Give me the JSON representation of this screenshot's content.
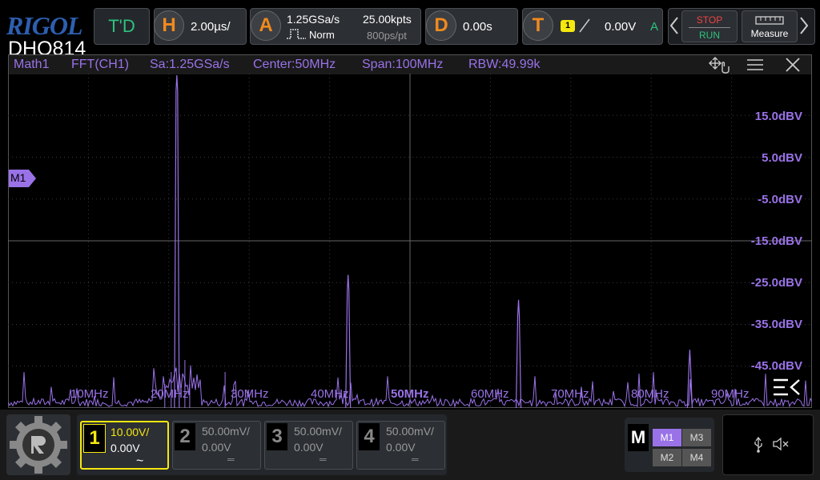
{
  "brand": {
    "logo": "RIGOL",
    "model": "DHO814"
  },
  "topbar": {
    "trigger_status": "T'D",
    "horizontal": {
      "badge": "H",
      "timebase": "2.00µs/"
    },
    "acquire": {
      "badge": "A",
      "sample_rate": "1.25GSa/s",
      "mode": "Norm",
      "memory_depth": "25.00kpts",
      "resolution": "800ps/pt"
    },
    "delay": {
      "badge": "D",
      "value": "0.00s"
    },
    "trigger": {
      "badge": "T",
      "source": "1",
      "level": "0.00V",
      "mode": "A"
    },
    "run_stop": {
      "stop": "STOP",
      "run": "RUN"
    },
    "measure_label": "Measure"
  },
  "math": {
    "title": "Math1",
    "source": "FFT(CH1)",
    "sample_rate": "Sa:1.25GSa/s",
    "center": "Center:50MHz",
    "span": "Span:100MHz",
    "rbw": "RBW:49.99k",
    "marker": "M1"
  },
  "yaxis_labels": [
    "15.0dBV",
    "5.0dBV",
    "-5.0dBV",
    "-15.0dBV",
    "-25.0dBV",
    "-35.0dBV",
    "-45.0dBV"
  ],
  "xaxis_labels": [
    "10MHz",
    "20MHz",
    "30MHz",
    "40MHz",
    "50MHz",
    "60MHz",
    "70MHz",
    "80MHz",
    "90MHz"
  ],
  "spectrum_peaks_mhz_dbv": [
    {
      "f": 21.0,
      "db": 25.0
    },
    {
      "f": 42.3,
      "db": -23.0
    },
    {
      "f": 63.5,
      "db": -29.0
    },
    {
      "f": 84.8,
      "db": -41.0
    }
  ],
  "channels": [
    {
      "num": "1",
      "scale": "10.00V/",
      "offset": "0.00V",
      "coupling": "~",
      "active": true,
      "color": "#f5e80f"
    },
    {
      "num": "2",
      "scale": "50.00mV/",
      "offset": "0.00V",
      "coupling": "═",
      "active": false,
      "color": "#888888"
    },
    {
      "num": "3",
      "scale": "50.00mV/",
      "offset": "0.00V",
      "coupling": "═",
      "active": false,
      "color": "#888888"
    },
    {
      "num": "4",
      "scale": "50.00mV/",
      "offset": "0.00V",
      "coupling": "═",
      "active": false,
      "color": "#888888"
    }
  ],
  "math_menu": {
    "label": "M",
    "items": [
      "M1",
      "M3",
      "M2",
      "M4"
    ]
  },
  "status_icons": [
    "usb-icon",
    "speaker-muted-icon"
  ],
  "colors": {
    "math": "#9a72e8",
    "ch1": "#f5e80f",
    "trigger_accent": "#f08a1e",
    "status_green": "#2ec27e"
  }
}
